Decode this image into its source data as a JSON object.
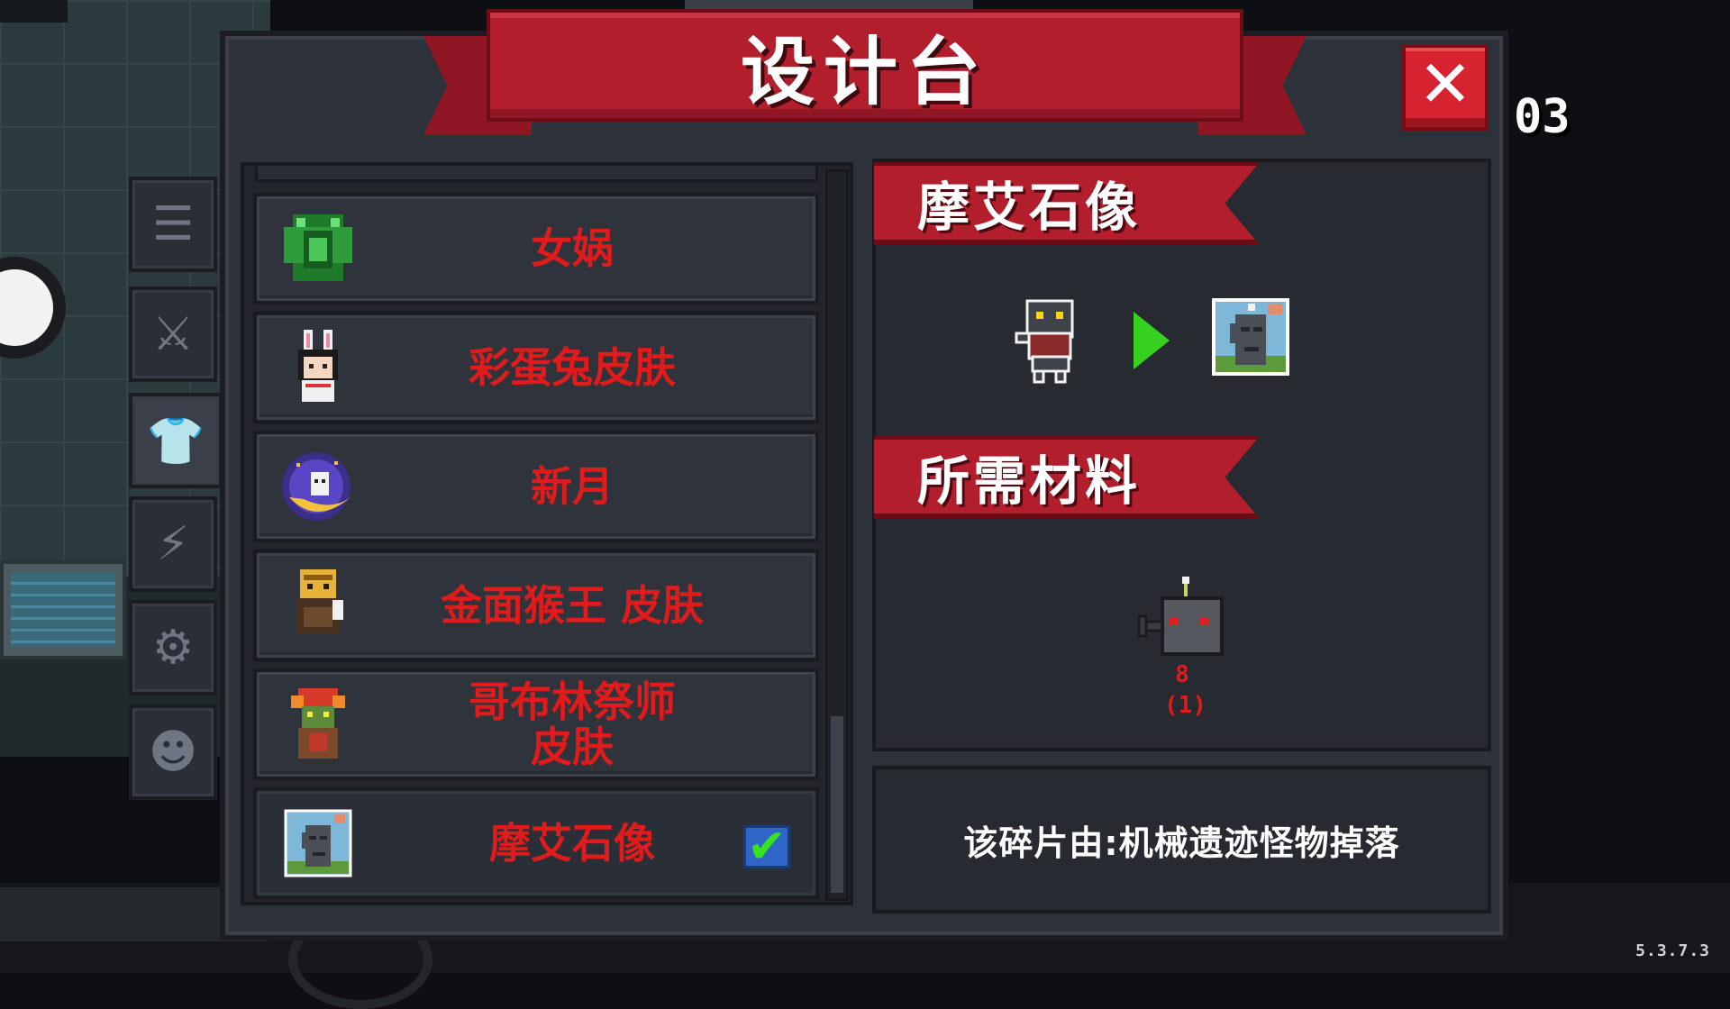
{
  "window": {
    "title": "设计台",
    "counter": "03",
    "version": "5.3.7.3"
  },
  "close_label": "✕",
  "tabs": [
    {
      "icon": "list-icon",
      "glyph": "☰"
    },
    {
      "icon": "weapon-icon",
      "glyph": "⚔"
    },
    {
      "icon": "shirt-icon",
      "glyph": "👕"
    },
    {
      "icon": "lightning-icon",
      "glyph": "⚡"
    },
    {
      "icon": "robot-icon",
      "glyph": "⚙"
    },
    {
      "icon": "pet-icon",
      "glyph": "☻"
    }
  ],
  "list": {
    "items": [
      {
        "label": "女娲",
        "icon": "nuwa-icon"
      },
      {
        "label": "彩蛋兔皮肤",
        "icon": "bunny-icon"
      },
      {
        "label": "新月",
        "icon": "crescent-icon"
      },
      {
        "label": "金面猴王 皮肤",
        "icon": "monkey-king-icon"
      },
      {
        "label": "哥布林祭师\n皮肤",
        "icon": "goblin-priest-icon"
      },
      {
        "label": "摩艾石像",
        "icon": "moai-icon",
        "selected": true,
        "check": "✔"
      }
    ]
  },
  "detail": {
    "name": "摩艾石像",
    "materials_title": "所需材料",
    "material_count": "8",
    "material_owned": "(1)",
    "description": "该碎片由:机械遗迹怪物掉落"
  },
  "colors": {
    "accent_red": "#b21e2c",
    "item_text": "#e01b1b",
    "arrow": "#37d21f"
  }
}
